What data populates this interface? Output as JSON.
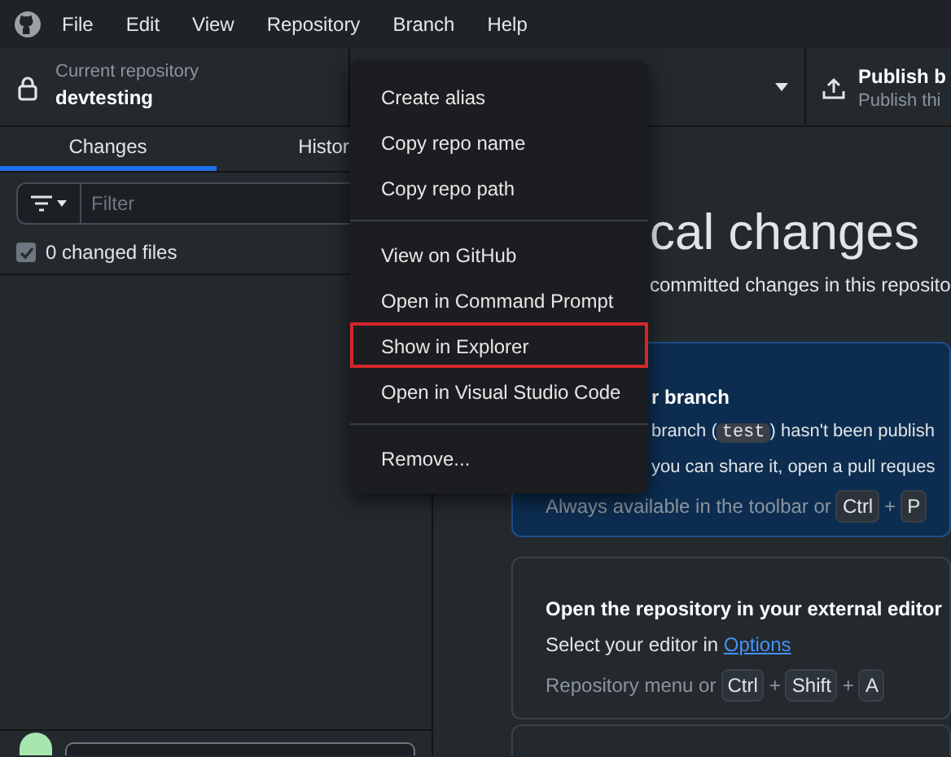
{
  "menu_bar": [
    "File",
    "Edit",
    "View",
    "Repository",
    "Branch",
    "Help"
  ],
  "toolbar": {
    "repository": {
      "label": "Current repository",
      "name": "devtesting"
    },
    "publish": {
      "title": "Publish b",
      "subtitle": "Publish thi"
    }
  },
  "tabs": [
    {
      "label": "Changes",
      "selected": true
    },
    {
      "label": "Histor",
      "selected": false
    }
  ],
  "filter": {
    "placeholder": "Filter"
  },
  "changed_files": {
    "label": "0 changed files",
    "checked": true
  },
  "main": {
    "heading": "cal changes",
    "subtitle": "committed changes in this reposito",
    "cards": [
      {
        "kind": "publish",
        "title": "r branch",
        "line_1": {
          "before": "branch (",
          "code": "test",
          "after": ") hasn't been publish"
        },
        "line_2": "you can share it, open a pull reques",
        "hint": "Always available in the toolbar or",
        "keys": [
          {
            "kind": "key",
            "text": "Ctrl"
          },
          {
            "kind": "plus",
            "text": "+"
          },
          {
            "kind": "key",
            "text": "P"
          }
        ]
      },
      {
        "kind": "editor",
        "title": "Open the repository in your external editor",
        "text": "Select your editor in",
        "link": "Options",
        "hint": "Repository menu or",
        "keys": [
          {
            "kind": "key",
            "text": "Ctrl"
          },
          {
            "kind": "plus",
            "text": "+"
          },
          {
            "kind": "key",
            "text": "Shift"
          },
          {
            "kind": "plus",
            "text": "+"
          },
          {
            "kind": "key",
            "text": "A"
          }
        ]
      }
    ]
  },
  "context_menu": [
    [
      {
        "label": "Create alias",
        "highlighted": false
      },
      {
        "label": "Copy repo name",
        "highlighted": false
      },
      {
        "label": "Copy repo path",
        "highlighted": false
      }
    ],
    [
      {
        "label": "View on GitHub",
        "highlighted": false
      },
      {
        "label": "Open in Command Prompt",
        "highlighted": false
      },
      {
        "label": "Show in Explorer",
        "highlighted": true
      },
      {
        "label": "Open in Visual Studio Code",
        "highlighted": false
      }
    ],
    [
      {
        "label": "Remove...",
        "highlighted": false
      }
    ]
  ]
}
